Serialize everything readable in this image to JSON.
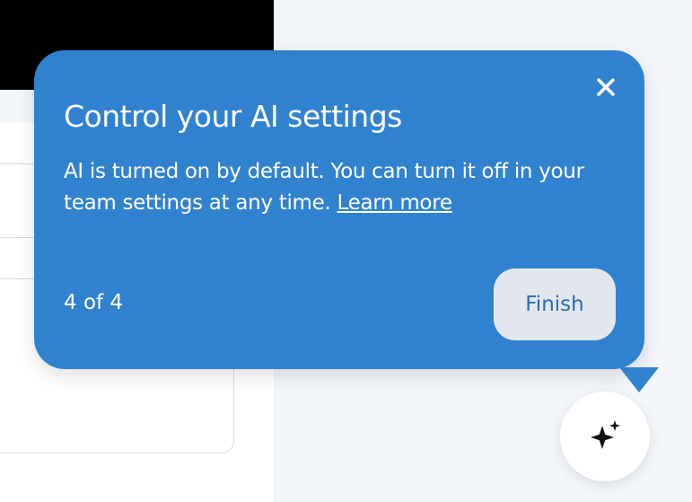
{
  "tour": {
    "title": "Control your AI settings",
    "body": "AI is turned on by default. You can turn it off in your team settings at any time.",
    "learn_more": "Learn more",
    "step": "4 of 4",
    "finish_label": "Finish",
    "close_icon": "close-icon"
  },
  "fab": {
    "icon": "sparkles-icon"
  },
  "colors": {
    "popover_bg": "#3182ce",
    "finish_bg": "#e2e8ee",
    "finish_text": "#2b6cb0",
    "page_bg": "#f2f5f9"
  }
}
